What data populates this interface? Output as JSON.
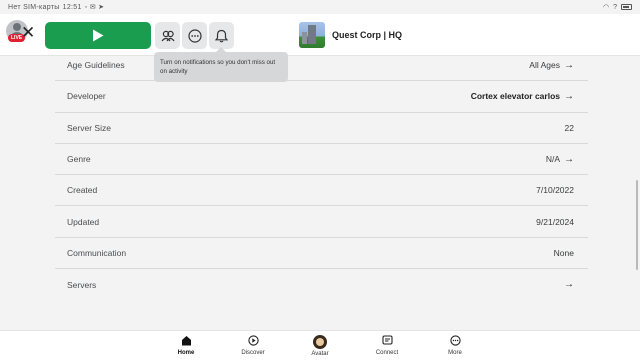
{
  "status_bar": {
    "carrier": "Нет SIM-карты",
    "time": "12:51",
    "battery_text": "?"
  },
  "header": {
    "live_badge": "LIVE",
    "tooltip": "Turn on notifications so you don't miss out on activity",
    "game_title": "Quest Corp | HQ"
  },
  "details": [
    {
      "label": "Age Guidelines",
      "value": "All Ages",
      "bold": false,
      "arrow": true
    },
    {
      "label": "Developer",
      "value": "Cortex elevator carlos",
      "bold": true,
      "arrow": true
    },
    {
      "label": "Server Size",
      "value": "22",
      "bold": false,
      "arrow": false
    },
    {
      "label": "Genre",
      "value": "N/A",
      "bold": false,
      "arrow": true
    },
    {
      "label": "Created",
      "value": "7/10/2022",
      "bold": false,
      "arrow": false
    },
    {
      "label": "Updated",
      "value": "9/21/2024",
      "bold": false,
      "arrow": false
    },
    {
      "label": "Communication",
      "value": "None",
      "bold": false,
      "arrow": false
    },
    {
      "label": "Servers",
      "value": "",
      "bold": false,
      "arrow": true
    }
  ],
  "bottom_nav": [
    {
      "label": "Home",
      "icon": "home-icon",
      "active": true
    },
    {
      "label": "Discover",
      "icon": "discover-icon",
      "active": false
    },
    {
      "label": "Avatar",
      "icon": "avatar-icon",
      "active": false
    },
    {
      "label": "Connect",
      "icon": "connect-icon",
      "active": false
    },
    {
      "label": "More",
      "icon": "more-icon",
      "active": false
    }
  ],
  "colors": {
    "play_button": "#1a9d4e",
    "live_badge": "#e0202e"
  }
}
